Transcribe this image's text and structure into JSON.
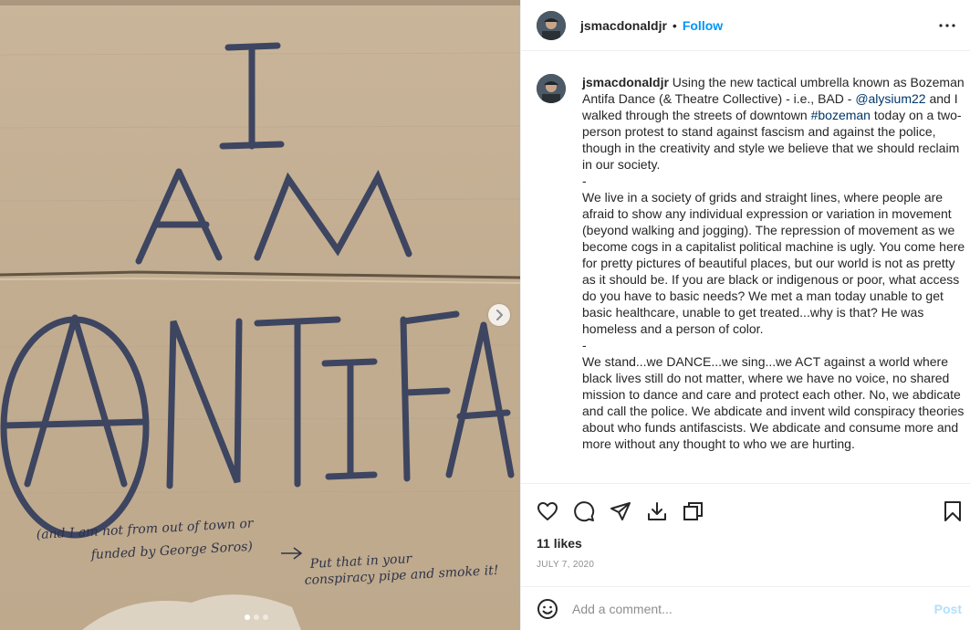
{
  "media": {
    "sign_lines": [
      "I",
      "AM",
      "ANTIFA"
    ],
    "note_line1": "(and I am not from out of town or",
    "note_line2": "funded by George Soros)",
    "note_line3": "Put that in your",
    "note_line4": "conspiracy pipe and smoke it!",
    "carousel": {
      "total": 3,
      "active": 0
    }
  },
  "header": {
    "username": "jsmacdonaldjr",
    "separator": "•",
    "follow_label": "Follow"
  },
  "caption": {
    "username": "jsmacdonaldjr",
    "part1": " Using the new tactical umbrella known as Bozeman Antifa Dance (& Theatre Collective) - i.e., BAD - ",
    "mention": "@alysium22",
    "part2": " and I walked through the streets of downtown ",
    "hashtag": "#bozeman",
    "part3": " today on a two-person protest to stand against fascism and against the police, though in the creativity and style we believe that we should reclaim in our society.\n-\nWe live in a society of grids and straight lines, where people are afraid to show any individual expression or variation in movement (beyond walking and jogging). The repression of movement as we become cogs in a capitalist political machine is ugly. You come here for pretty pictures of beautiful places, but our world is not as pretty as it should be. If you are black or indigenous or poor, what access do you have to basic needs? We met a man today unable to get basic healthcare, unable to get treated...why is that? He was homeless and a person of color.\n-\nWe stand...we DANCE...we sing...we ACT against a world where black lives still do not matter, where we have no voice, no shared mission to dance and care and protect each other. No, we abdicate and call the police. We abdicate and invent wild conspiracy theories about who funds antifascists. We abdicate and consume more and more without any thought to who we are hurting."
  },
  "actions": {
    "icons": [
      "heart-icon",
      "comment-icon",
      "share-icon",
      "download-icon",
      "copy-icon",
      "bookmark-icon"
    ]
  },
  "likes_text": "11 likes",
  "date_text": "JULY 7, 2020",
  "add_comment": {
    "placeholder": "Add a comment...",
    "post_label": "Post"
  },
  "colors": {
    "accent": "#0095f6",
    "link": "#00376b",
    "muted": "#8e8e8e",
    "post_disabled": "#b2dffc"
  }
}
